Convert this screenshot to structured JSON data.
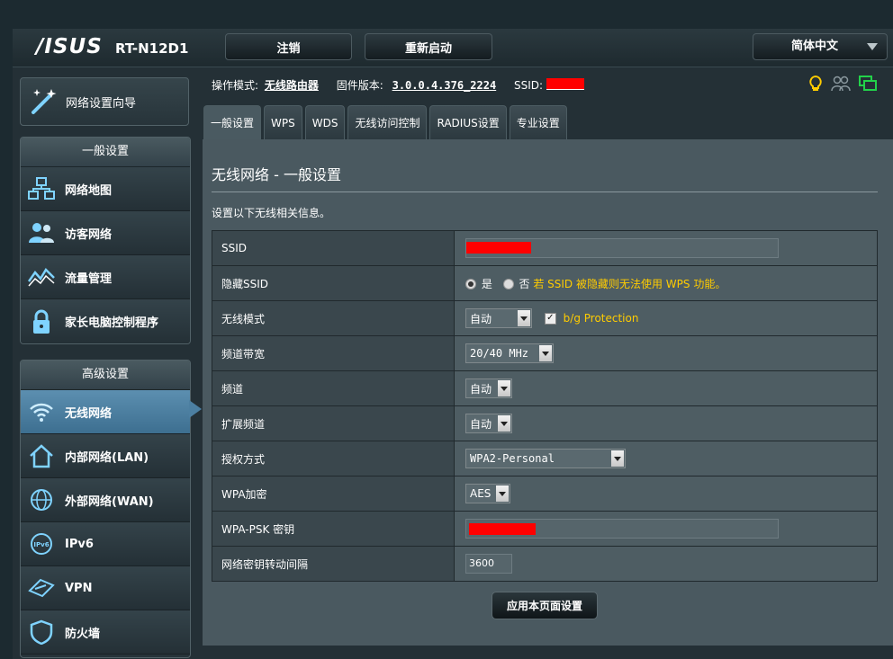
{
  "header": {
    "logo": "/ISUS",
    "model": "RT-N12D1",
    "logout_label": "注销",
    "reboot_label": "重新启动",
    "language": "简体中文"
  },
  "sidebar": {
    "wizard_label": "网络设置向导",
    "general_head": "一般设置",
    "general_items": [
      {
        "label": "网络地图",
        "icon": "network-map-icon"
      },
      {
        "label": "访客网络",
        "icon": "guest-network-icon"
      },
      {
        "label": "流量管理",
        "icon": "traffic-manager-icon"
      },
      {
        "label": "家长电脑控制程序",
        "icon": "parental-lock-icon"
      }
    ],
    "advanced_head": "高级设置",
    "advanced_items": [
      {
        "label": "无线网络",
        "icon": "wireless-icon",
        "active": true
      },
      {
        "label": "内部网络(LAN)",
        "icon": "home-lan-icon"
      },
      {
        "label": "外部网络(WAN)",
        "icon": "globe-wan-icon"
      },
      {
        "label": "IPv6",
        "icon": "ipv6-icon"
      },
      {
        "label": "VPN",
        "icon": "vpn-icon"
      },
      {
        "label": "防火墙",
        "icon": "firewall-icon"
      }
    ]
  },
  "info_bar": {
    "mode_label": "操作模式:",
    "mode_value": "无线路由器",
    "firmware_label": "固件版本:",
    "firmware_value": "3.0.0.4.376_2224",
    "ssid_label": "SSID:"
  },
  "tabs": [
    "一般设置",
    "WPS",
    "WDS",
    "无线访问控制",
    "RADIUS设置",
    "专业设置"
  ],
  "panel": {
    "title": "无线网络 - 一般设置",
    "description": "设置以下无线相关信息。",
    "rows": {
      "ssid": "SSID",
      "hide_ssid": "隐藏SSID",
      "hide_yes": "是",
      "hide_no": "否",
      "hide_note": "若 SSID 被隐藏则无法使用 WPS 功能。",
      "wireless_mode": "无线模式",
      "wireless_mode_value": "自动",
      "bg_protection": "b/g Protection",
      "bandwidth": "频道带宽",
      "bandwidth_value": "20/40 MHz",
      "channel": "频道",
      "channel_value": "自动",
      "ext_channel": "扩展频道",
      "ext_channel_value": "自动",
      "auth": "授权方式",
      "auth_value": "WPA2-Personal",
      "wpa_enc": "WPA加密",
      "wpa_enc_value": "AES",
      "psk": "WPA-PSK 密钥",
      "rekey": "网络密钥转动间隔",
      "rekey_value": "3600"
    },
    "apply_label": "应用本页面设置"
  },
  "colors": {
    "accent_active": "#4c7fa1",
    "warning_text": "#ffcc00",
    "redaction": "#ff0000"
  }
}
